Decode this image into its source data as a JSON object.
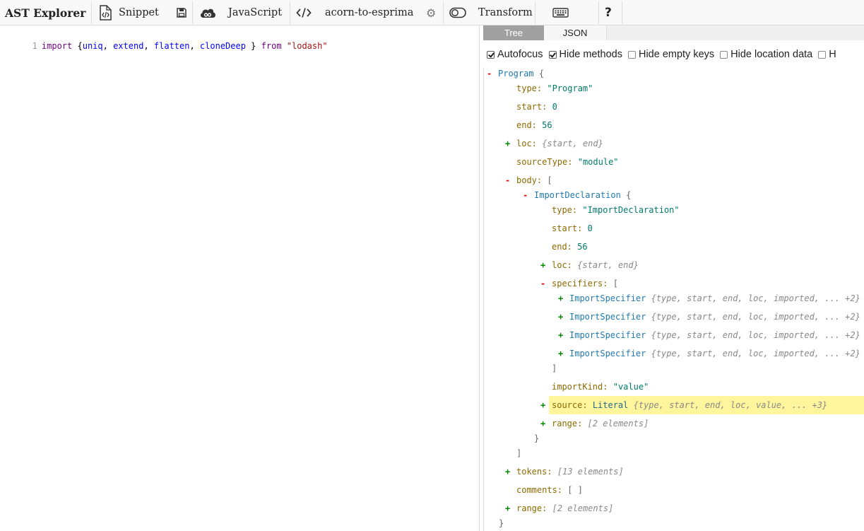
{
  "toolbar": {
    "brand": "AST Explorer",
    "snippet_label": "Snippet",
    "language_label": "JavaScript",
    "parser_label": "acorn-to-esprima",
    "transform_label": "Transform",
    "help_label": "?"
  },
  "editor": {
    "line_number": "1",
    "tokens": {
      "t1": "import",
      "t2": " {",
      "t3": "uniq",
      "t4": ", ",
      "t5": "extend",
      "t6": ", ",
      "t7": "flatten",
      "t8": ", ",
      "t9": "cloneDeep",
      "t10": " } ",
      "t11": "from",
      "t12": " ",
      "t13": "\"lodash\""
    }
  },
  "tabs": {
    "tree": "Tree",
    "json": "JSON"
  },
  "options": {
    "autofocus": "Autofocus",
    "hide_methods": "Hide methods",
    "hide_empty_keys": "Hide empty keys",
    "hide_location_data": "Hide location data",
    "partial": "H"
  },
  "tree": {
    "program": {
      "name": "Program",
      "open": "{",
      "close": "}"
    },
    "type_key": "type:",
    "type_val": "\"Program\"",
    "start_key": "start:",
    "start_val": "0",
    "end_key": "end:",
    "end_val": "56",
    "loc_key": "loc:",
    "loc_summary": "{start, end}",
    "sourceType_key": "sourceType:",
    "sourceType_val": "\"module\"",
    "body_key": "body:",
    "body_open": "[",
    "body_close": "]",
    "import_decl": "ImportDeclaration",
    "import_decl_open": "{",
    "import_decl_close": "}",
    "id_type_key": "type:",
    "id_type_val": "\"ImportDeclaration\"",
    "id_start_key": "start:",
    "id_start_val": "0",
    "id_end_key": "end:",
    "id_end_val": "56",
    "id_loc_key": "loc:",
    "id_loc_summary": "{start, end}",
    "specifiers_key": "specifiers:",
    "specifiers_open": "[",
    "specifiers_close": "]",
    "specifiers": [
      {
        "name": "ImportSpecifier",
        "summary": "{type, start, end, loc, imported, ... +2}"
      },
      {
        "name": "ImportSpecifier",
        "summary": "{type, start, end, loc, imported, ... +2}"
      },
      {
        "name": "ImportSpecifier",
        "summary": "{type, start, end, loc, imported, ... +2}"
      },
      {
        "name": "ImportSpecifier",
        "summary": "{type, start, end, loc, imported, ... +2}"
      }
    ],
    "importKind_key": "importKind:",
    "importKind_val": "\"value\"",
    "source_key": "source:",
    "source_type": "Literal",
    "source_summary": "{type, start, end, loc, value, ... +3}",
    "id_range_key": "range:",
    "id_range_summary": "[2 elements]",
    "tokens_key": "tokens:",
    "tokens_summary": "[13 elements]",
    "comments_key": "comments:",
    "comments_val": "[ ]",
    "range_key": "range:",
    "range_summary": "[2 elements]"
  },
  "colors": {
    "highlight": "#fff59d",
    "minus": "#dd0000",
    "plus": "#008800",
    "key": "#8b6a00",
    "type": "#1f79b0"
  }
}
